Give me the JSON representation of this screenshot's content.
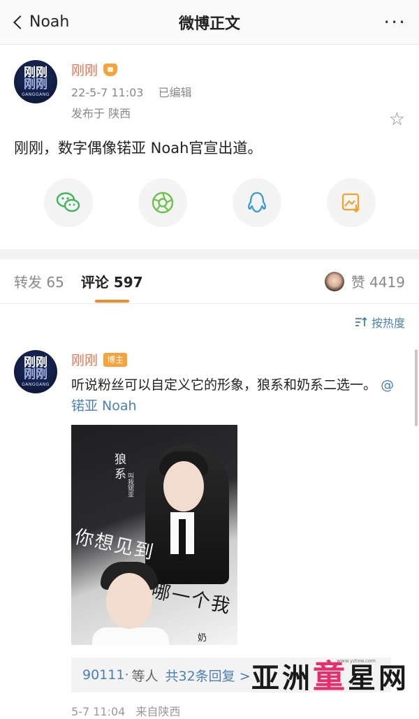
{
  "nav": {
    "back_label": "Noah",
    "title": "微博正文",
    "more_label": "···"
  },
  "post": {
    "avatar_line1": "刚刚",
    "avatar_line2": "刚刚",
    "avatar_caption": "GANGGANG",
    "username": "刚刚",
    "time": "22-5-7 11:03",
    "edited": "已编辑",
    "location": "发布于 陕西",
    "text": "刚刚，数字偶像锘亚 Noah官宣出道。",
    "share_icons": [
      "wechat-icon",
      "moments-icon",
      "qq-icon",
      "save-image-icon"
    ]
  },
  "tabs": {
    "repost": "转发 65",
    "comment": "评论 597",
    "likes": "赞 4419"
  },
  "sort": {
    "label": "按热度"
  },
  "comment": {
    "avatar_line1": "刚刚",
    "avatar_line2": "刚刚",
    "avatar_caption": "GANGGANG",
    "username": "刚刚",
    "badge": "博主",
    "text": "听说粉丝可以自定义它的形象，狼系和奶系二选一。",
    "mention": "@锘亚 Noah",
    "poster": {
      "main_text": "你想见到",
      "sub_text": "哪一个我",
      "side_title": "狼系",
      "side_small": "叫我锘亚",
      "bottom_text": "奶"
    },
    "reply_user": "90111·",
    "reply_etc": "等人",
    "reply_count": "共32条回复 >",
    "time": "5-7 11:04",
    "source": "来自陕西"
  },
  "watermark": {
    "part1": "亚洲",
    "part2": "童",
    "part3": "星网",
    "url": "www.yztxw.com"
  }
}
